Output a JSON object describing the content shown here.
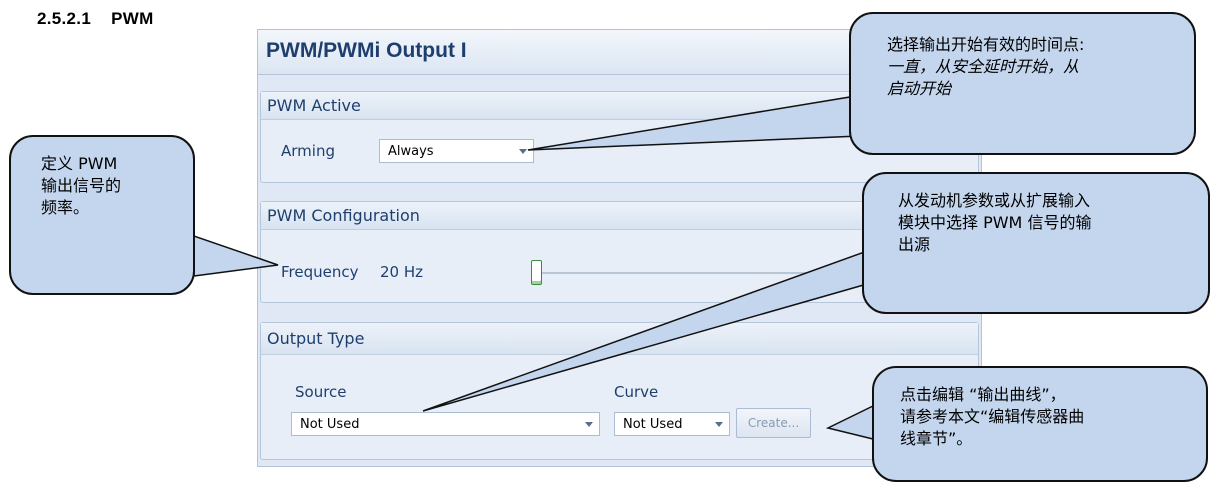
{
  "section": {
    "number": "2.5.2.1",
    "title": "PWM"
  },
  "window": {
    "title": "PWM/PWMi Output I"
  },
  "pwm_active": {
    "title": "PWM Active",
    "arming_label": "Arming",
    "arming_value": "Always"
  },
  "pwm_config": {
    "title": "PWM Configuration",
    "frequency_label": "Frequency",
    "frequency_value": "20 Hz",
    "slider_level": 0
  },
  "output_type": {
    "title": "Output Type",
    "source_label": "Source",
    "source_value": "Not Used",
    "curve_label": "Curve",
    "curve_value": "Not Used",
    "create_label": "Create..."
  },
  "callouts": {
    "arming": {
      "line1": "选择输出开始有效的时间点:",
      "line2": "一直，从安全延时开始，从",
      "line3": "启动开始"
    },
    "frequency": {
      "line1": "定义 PWM",
      "line2": "输出信号的",
      "line3": "频率。"
    },
    "source": {
      "line1": "从发动机参数或从扩展输入",
      "line2": "模块中选择 PWM 信号的输",
      "line3": "出源"
    },
    "curve": {
      "line1": "点击编辑 “输出曲线”，",
      "line2": "请参考本文“编辑传感器曲",
      "line3": "线章节”。"
    }
  },
  "colors": {
    "callout_fill": "#c4d6ee",
    "header_text": "#1e3f6e",
    "panel_bg": "#dfe8f4"
  }
}
